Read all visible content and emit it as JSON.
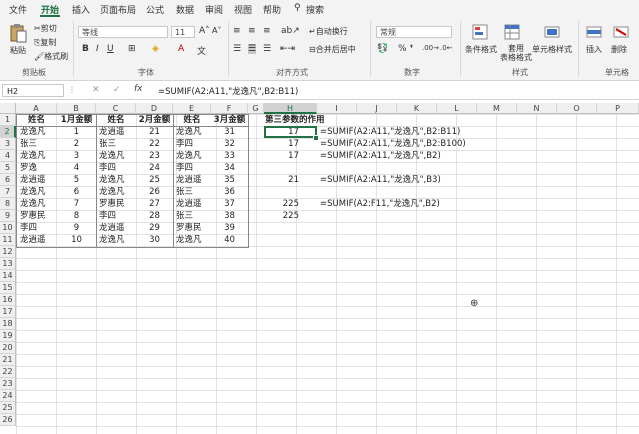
{
  "menu": [
    "文件",
    "开始",
    "插入",
    "页面布局",
    "公式",
    "数据",
    "审阅",
    "视图",
    "帮助",
    "搜索"
  ],
  "ribbon": {
    "clipboard": {
      "paste": "粘贴",
      "cut": "剪切",
      "copy": "复制",
      "format_painter": "格式刷",
      "label": "剪贴板"
    },
    "font": {
      "name": "等线",
      "size": "11",
      "label": "字体"
    },
    "alignment": {
      "wrap": "自动换行",
      "merge": "合并后居中",
      "label": "对齐方式"
    },
    "number": {
      "format": "常规",
      "label": "数字"
    },
    "styles": {
      "conditional": "条件格式",
      "table": "套用\n表格格式",
      "cell": "单元格样式",
      "label": "样式"
    },
    "cells": {
      "insert": "插入",
      "delete": "删除",
      "label": "单元格"
    }
  },
  "formula_bar": {
    "name_box": "H2",
    "formula": "=SUMIF(A2:A11,\"龙逸凡\",B2:B11)"
  },
  "columns": [
    "A",
    "B",
    "C",
    "D",
    "E",
    "F",
    "G",
    "H",
    "I",
    "J",
    "K",
    "L",
    "M",
    "N",
    "O",
    "P"
  ],
  "rows": [
    "1",
    "2",
    "3",
    "4",
    "5",
    "6",
    "7",
    "8",
    "9",
    "10",
    "11",
    "12",
    "13",
    "14",
    "15",
    "16",
    "17",
    "18",
    "19",
    "20",
    "21",
    "22",
    "23",
    "24",
    "25",
    "26"
  ],
  "sheet": {
    "headers": [
      "姓名",
      "1月金额",
      "姓名",
      "2月金额",
      "姓名",
      "3月金额"
    ],
    "data": [
      [
        "龙逸凡",
        "1",
        "龙逍遥",
        "21",
        "龙逸凡",
        "31"
      ],
      [
        "张三",
        "2",
        "张三",
        "22",
        "李四",
        "32"
      ],
      [
        "龙逸凡",
        "3",
        "龙逸凡",
        "23",
        "龙逸凡",
        "33"
      ],
      [
        "罗逸",
        "4",
        "李四",
        "24",
        "李四",
        "34"
      ],
      [
        "龙逍遥",
        "5",
        "龙逸凡",
        "25",
        "龙逍遥",
        "35"
      ],
      [
        "龙逸凡",
        "6",
        "龙逸凡",
        "26",
        "张三",
        "36"
      ],
      [
        "龙逸凡",
        "7",
        "罗惠民",
        "27",
        "龙逍遥",
        "37"
      ],
      [
        "罗惠民",
        "8",
        "李四",
        "28",
        "张三",
        "38"
      ],
      [
        "李四",
        "9",
        "龙逍遥",
        "29",
        "罗惠民",
        "39"
      ],
      [
        "龙逍遥",
        "10",
        "龙逸凡",
        "30",
        "龙逸凡",
        "40"
      ]
    ],
    "section_title": "第三参数的作用",
    "results": [
      {
        "value": "17",
        "formula": "=SUMIF(A2:A11,\"龙逸凡\",B2:B11)"
      },
      {
        "value": "17",
        "formula": "=SUMIF(A2:A11,\"龙逸凡\",B2:B100)"
      },
      {
        "value": "17",
        "formula": "=SUMIF(A2:A11,\"龙逸凡\",B2)"
      },
      {
        "value": "",
        "formula": ""
      },
      {
        "value": "21",
        "formula": "=SUMIF(A2:A11,\"龙逸凡\",B3)"
      },
      {
        "value": "",
        "formula": ""
      },
      {
        "value": "225",
        "formula": "=SUMIF(A2:F11,\"龙逸凡\",B2)"
      },
      {
        "value": "225",
        "formula": ""
      }
    ]
  },
  "colors": {
    "accent": "#217346",
    "select_border": "#217346"
  }
}
